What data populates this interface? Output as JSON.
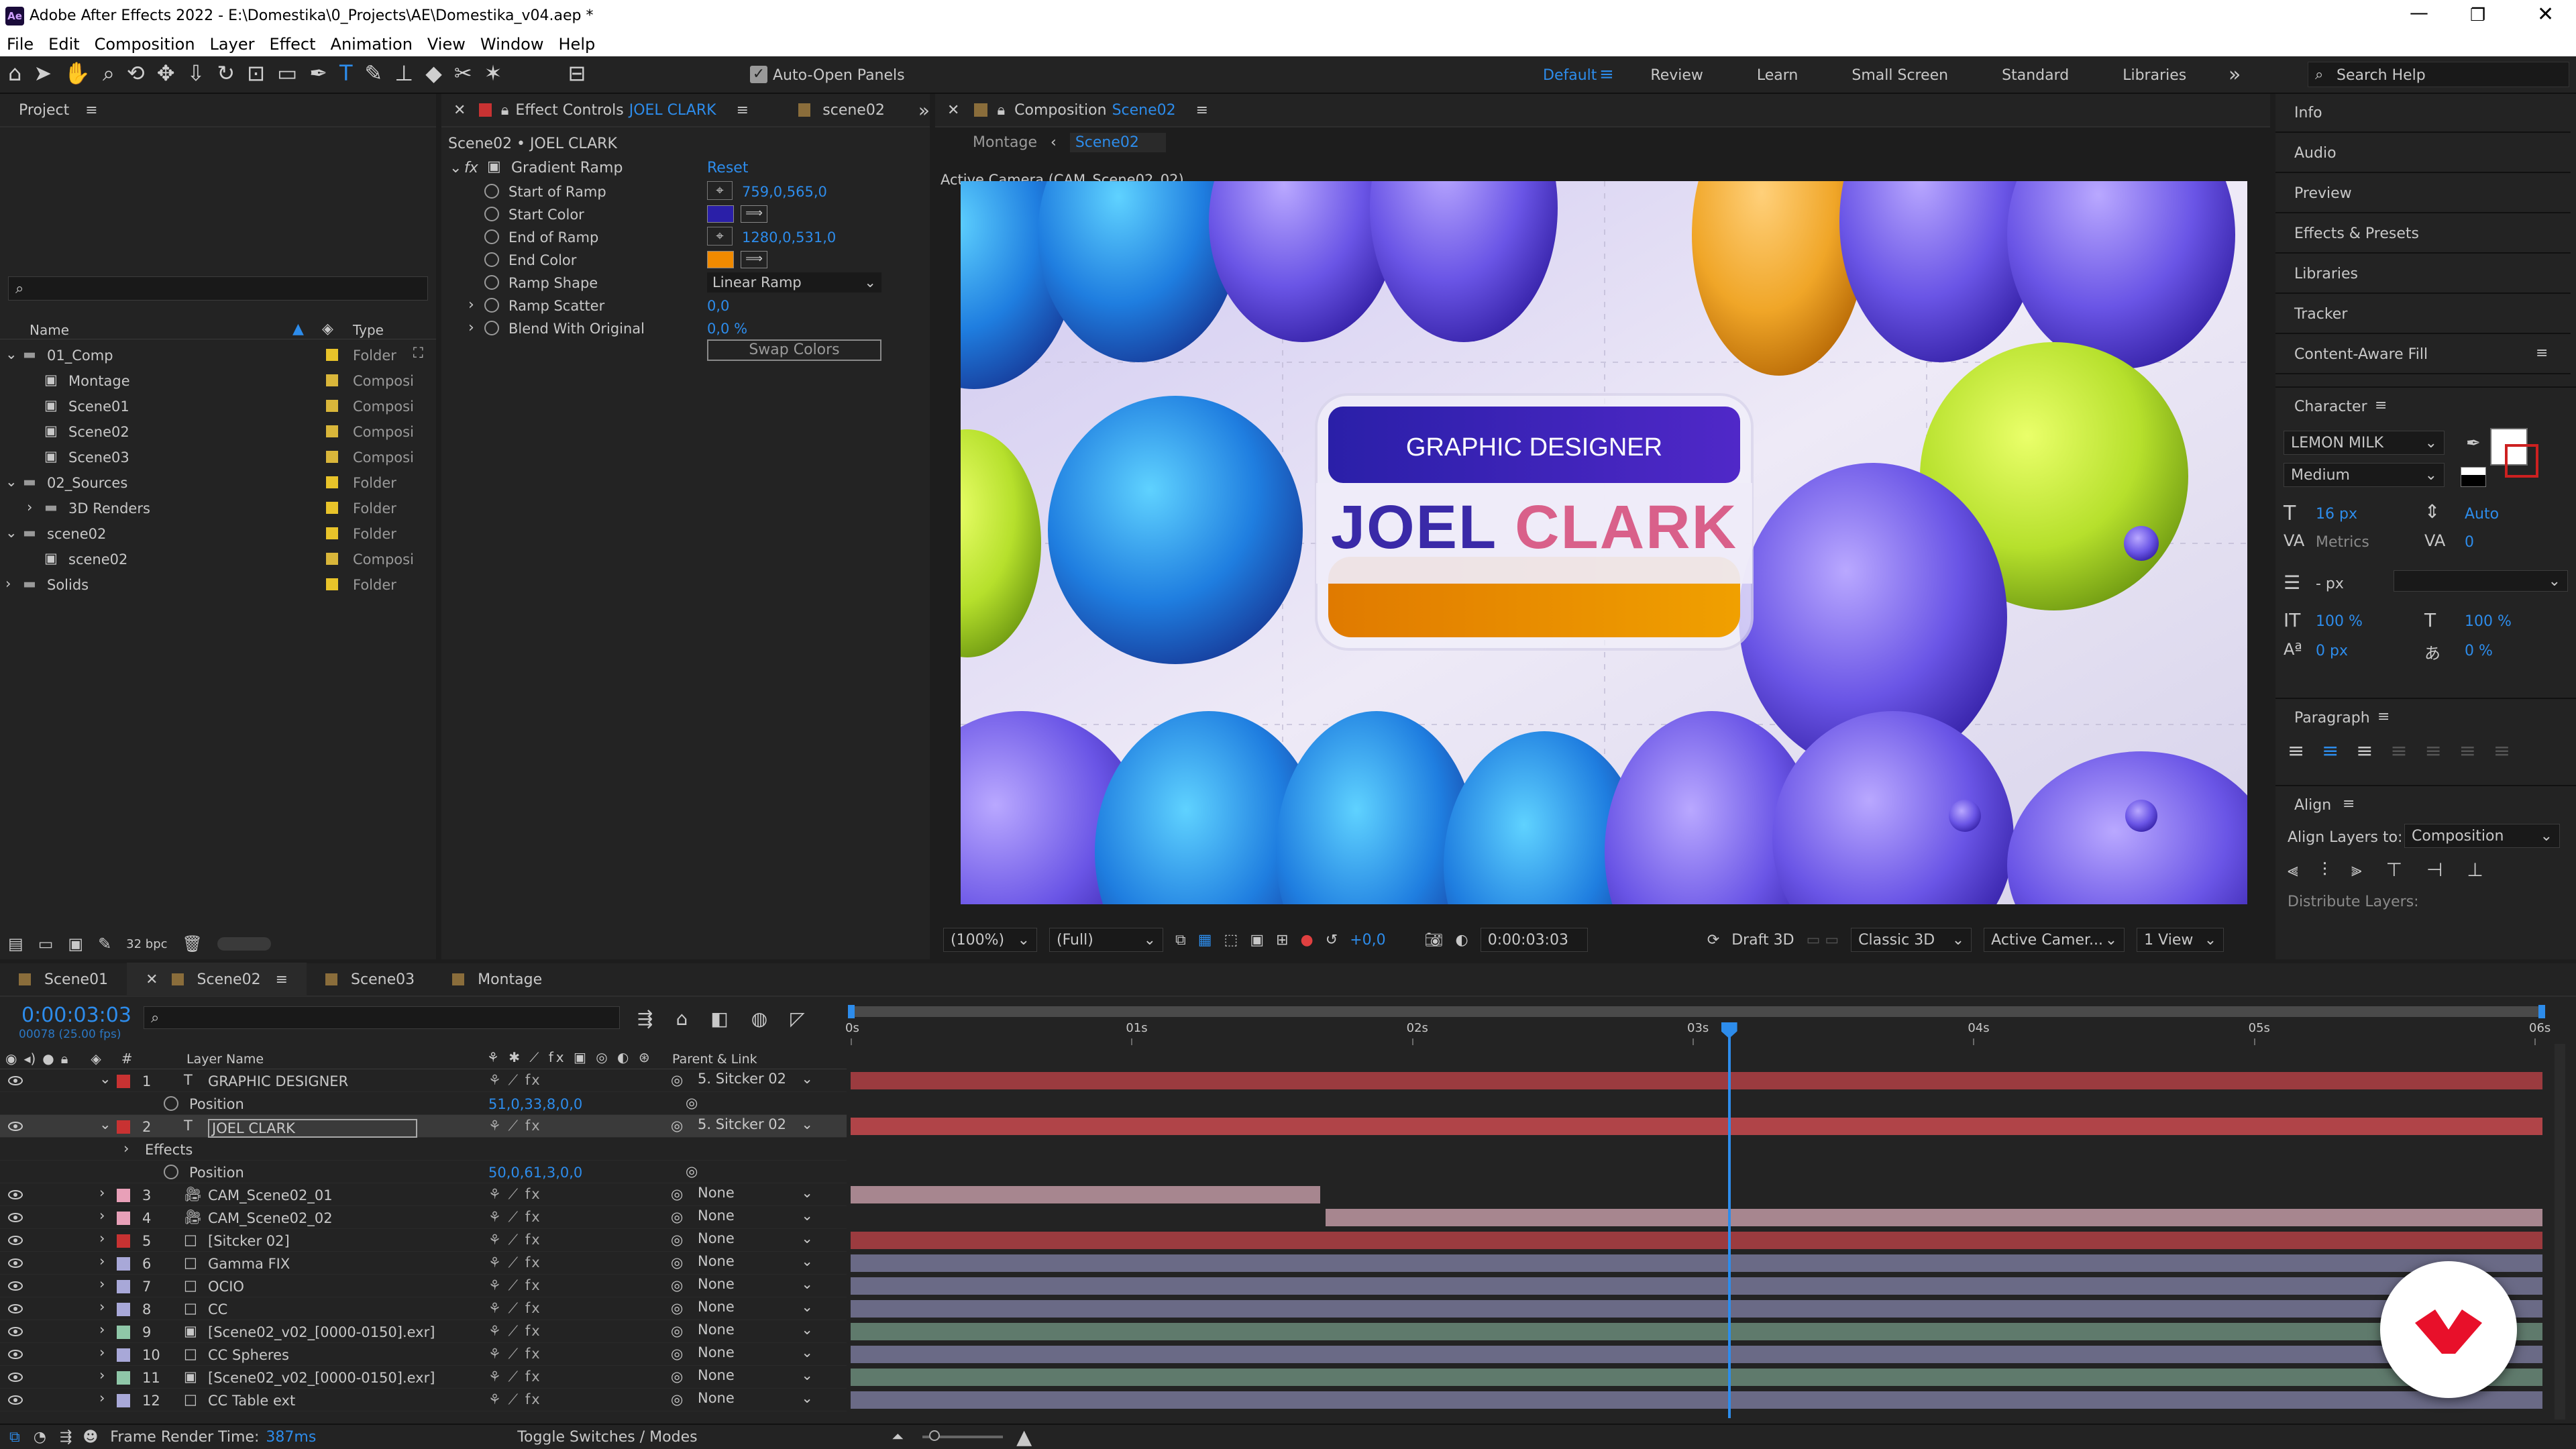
{
  "app": {
    "title": "Adobe After Effects 2022 - E:\\Domestika\\0_Projects\\AE\\Domestika_v04.aep *",
    "menu": [
      "File",
      "Edit",
      "Composition",
      "Layer",
      "Effect",
      "Animation",
      "View",
      "Window",
      "Help"
    ]
  },
  "toolbar": {
    "auto_open": "Auto-Open Panels",
    "workspaces": [
      "Default",
      "Review",
      "Learn",
      "Small Screen",
      "Standard",
      "Libraries"
    ],
    "search_help": "Search Help"
  },
  "project": {
    "title": "Project",
    "col_name": "Name",
    "col_type": "Type",
    "bpc": "32 bpc",
    "items": [
      {
        "name": "01_Comp",
        "type": "Folder",
        "indent": 0,
        "kind": "folder",
        "open": true
      },
      {
        "name": "Montage",
        "type": "Composi",
        "indent": 1,
        "kind": "comp"
      },
      {
        "name": "Scene01",
        "type": "Composi",
        "indent": 1,
        "kind": "comp"
      },
      {
        "name": "Scene02",
        "type": "Composi",
        "indent": 1,
        "kind": "comp"
      },
      {
        "name": "Scene03",
        "type": "Composi",
        "indent": 1,
        "kind": "comp"
      },
      {
        "name": "02_Sources",
        "type": "Folder",
        "indent": 0,
        "kind": "folder",
        "open": true
      },
      {
        "name": "3D Renders",
        "type": "Folder",
        "indent": 1,
        "kind": "folder",
        "open": false
      },
      {
        "name": "scene02",
        "type": "Folder",
        "indent": 0,
        "kind": "folder",
        "open": true
      },
      {
        "name": "scene02",
        "type": "Composi",
        "indent": 1,
        "kind": "comp"
      },
      {
        "name": "Solids",
        "type": "Folder",
        "indent": 0,
        "kind": "folder",
        "open": false
      }
    ]
  },
  "effect_controls": {
    "tab_label": "Effect Controls",
    "tab_layer": "JOEL CLARK",
    "other_tab": "scene02",
    "breadcrumb": "Scene02 • JOEL CLARK",
    "effect_name": "Gradient Ramp",
    "reset": "Reset",
    "props": [
      {
        "label": "Start of Ramp",
        "value": "759,0,565,0",
        "kind": "point"
      },
      {
        "label": "Start Color",
        "value": "",
        "kind": "color",
        "color": "#2a1fa8"
      },
      {
        "label": "End of Ramp",
        "value": "1280,0,531,0",
        "kind": "point"
      },
      {
        "label": "End Color",
        "value": "",
        "kind": "color",
        "color": "#f08a00"
      },
      {
        "label": "Ramp Shape",
        "value": "Linear Ramp",
        "kind": "select"
      },
      {
        "label": "Ramp Scatter",
        "value": "0,0",
        "kind": "num"
      },
      {
        "label": "Blend With Original",
        "value": "0,0 %",
        "kind": "num"
      }
    ],
    "swap": "Swap Colors"
  },
  "composition": {
    "tab_label": "Composition",
    "tab_comp": "Scene02",
    "crumb_1": "Montage",
    "crumb_2": "Scene02",
    "camera_label": "Active Camera (CAM_Scene02_02)",
    "card_subtitle": "GRAPHIC DESIGNER",
    "card_first": "JOEL",
    "card_last": "CLARK",
    "footer": {
      "zoom": "(100%)",
      "resolution": "(Full)",
      "exposure": "+0,0",
      "timecode": "0:00:03:03",
      "draft": "Draft 3D",
      "renderer": "Classic 3D",
      "camera": "Active Camer...",
      "views": "1 View"
    }
  },
  "right_panels": {
    "items": [
      "Info",
      "Audio",
      "Preview",
      "Effects & Presets",
      "Libraries",
      "Tracker",
      "Content-Aware Fill"
    ],
    "character": {
      "title": "Character",
      "font": "LEMON MILK",
      "style": "Medium",
      "size": "16 px",
      "leading": "Auto",
      "kerning": "Metrics",
      "tracking": "0",
      "stroke": "- px",
      "vscale": "100 %",
      "hscale": "100 %",
      "baseline": "0 px",
      "tsume": "0 %"
    },
    "paragraph": {
      "title": "Paragraph"
    },
    "align": {
      "title": "Align",
      "align_to_label": "Align Layers to:",
      "align_to_value": "Composition",
      "distribute": "Distribute Layers:"
    }
  },
  "timeline": {
    "tabs": [
      "Scene01",
      "Scene02",
      "Scene03",
      "Montage"
    ],
    "active_tab": "Scene02",
    "timecode": "0:00:03:03",
    "frames": "00078 (25.00 fps)",
    "col_layer_name": "Layer Name",
    "col_parent": "Parent & Link",
    "ruler": [
      "0s",
      "01s",
      "02s",
      "03s",
      "04s",
      "05s",
      "06s"
    ],
    "playhead_seconds": 3.12,
    "duration_seconds": 6.0,
    "layers": [
      {
        "num": "1",
        "name": "GRAPHIC DESIGNER",
        "icon": "T",
        "color": "#c83232",
        "parent": "5. Sitcker 02",
        "expanded": true,
        "bar_start": 0,
        "bar_end": 6,
        "bar_color": "#9b3b3f"
      },
      {
        "sub": true,
        "label": "Position",
        "value": "51,0,33,8,0,0"
      },
      {
        "num": "2",
        "name": "JOEL CLARK",
        "icon": "T",
        "color": "#c83232",
        "parent": "5. Sitcker 02",
        "expanded": true,
        "selected": true,
        "bar_start": 0,
        "bar_end": 6,
        "bar_color": "#b04448"
      },
      {
        "sub": true,
        "label": "Effects",
        "value": "",
        "twirl": true
      },
      {
        "sub": true,
        "label": "Position",
        "value": "50,0,61,3,0,0"
      },
      {
        "num": "3",
        "name": "CAM_Scene02_01",
        "icon": "cam",
        "color": "#e8a0b8",
        "parent": "None",
        "bar_start": 0,
        "bar_end": 1.68,
        "bar_color": "#a7868f"
      },
      {
        "num": "4",
        "name": "CAM_Scene02_02",
        "icon": "cam",
        "color": "#e8a0b8",
        "parent": "None",
        "bar_start": 1.68,
        "bar_end": 6,
        "bar_color": "#a7868f"
      },
      {
        "num": "5",
        "name": "[Sitcker 02]",
        "icon": "box",
        "color": "#c83232",
        "parent": "None",
        "bar_start": 0,
        "bar_end": 6,
        "bar_color": "#9b3b3f"
      },
      {
        "num": "6",
        "name": "Gamma FIX",
        "icon": "box",
        "color": "#a8a8d8",
        "parent": "None",
        "bar_start": 0,
        "bar_end": 6,
        "bar_color": "#6a6a86"
      },
      {
        "num": "7",
        "name": "OCIO",
        "icon": "box",
        "color": "#a8a8d8",
        "parent": "None",
        "bar_start": 0,
        "bar_end": 6,
        "bar_color": "#6a6a86"
      },
      {
        "num": "8",
        "name": "CC",
        "icon": "box",
        "color": "#a8a8d8",
        "parent": "None",
        "bar_start": 0,
        "bar_end": 6,
        "bar_color": "#6a6a86"
      },
      {
        "num": "9",
        "name": "[Scene02_v02_[0000-0150].exr]",
        "icon": "seq",
        "color": "#8fc7a8",
        "parent": "None",
        "bar_start": 0,
        "bar_end": 6,
        "bar_color": "#5f7a6c"
      },
      {
        "num": "10",
        "name": "CC Spheres",
        "icon": "box",
        "color": "#a8a8d8",
        "parent": "None",
        "bar_start": 0,
        "bar_end": 6,
        "bar_color": "#6a6a86"
      },
      {
        "num": "11",
        "name": "[Scene02_v02_[0000-0150].exr]",
        "icon": "seq",
        "color": "#8fc7a8",
        "parent": "None",
        "bar_start": 0,
        "bar_end": 6,
        "bar_color": "#5f7a6c"
      },
      {
        "num": "12",
        "name": "CC Table ext",
        "icon": "box",
        "color": "#a8a8d8",
        "parent": "None",
        "bar_start": 0,
        "bar_end": 6,
        "bar_color": "#6a6a86"
      }
    ],
    "frame_render_label": "Frame Render Time:",
    "frame_render_value": "387ms",
    "toggle_label": "Toggle Switches / Modes"
  },
  "colors": {
    "accent": "#2d8ceb",
    "panel": "#232323",
    "bg": "#1d1d1d",
    "playhead": "#2d8ceb"
  }
}
